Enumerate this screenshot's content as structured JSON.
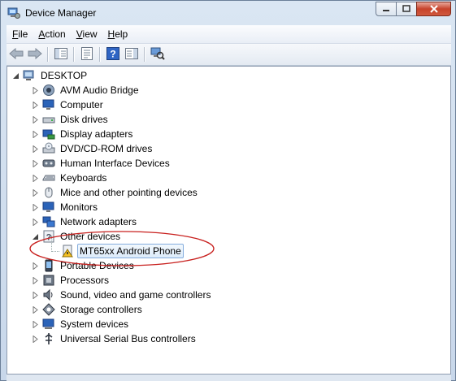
{
  "window": {
    "title": "Device Manager"
  },
  "menu": [
    {
      "key": "F",
      "rest": "ile"
    },
    {
      "key": "A",
      "rest": "ction"
    },
    {
      "key": "V",
      "rest": "iew"
    },
    {
      "key": "H",
      "rest": "elp"
    }
  ],
  "toolbar": {
    "icons": [
      "back-arrow-icon",
      "forward-arrow-icon",
      "show-hide-console-tree-icon",
      "properties-icon",
      "help-icon",
      "action-pane-icon",
      "scan-hardware-icon"
    ]
  },
  "tree": {
    "root": "DESKTOP",
    "categories": [
      "AVM Audio Bridge",
      "Computer",
      "Disk drives",
      "Display adapters",
      "DVD/CD-ROM drives",
      "Human Interface Devices",
      "Keyboards",
      "Mice and other pointing devices",
      "Monitors",
      "Network adapters",
      "Other devices",
      "MT65xx Android Phone",
      "Portable Devices",
      "Processors",
      "Sound, video and game controllers",
      "Storage controllers",
      "System devices",
      "Universal Serial Bus controllers"
    ]
  },
  "colors": {
    "accent": "#3a6fb5",
    "annotation": "#c8201e",
    "selection": "#dcebfa"
  }
}
